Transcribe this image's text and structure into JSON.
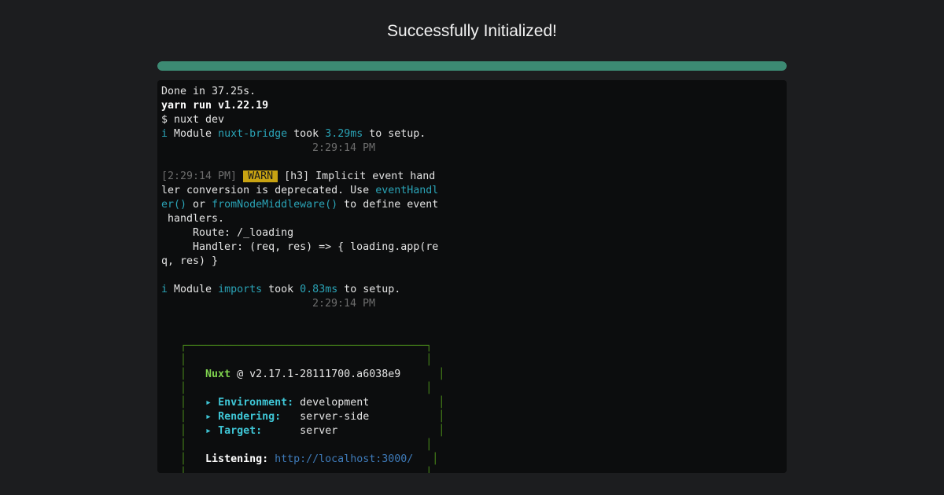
{
  "page": {
    "title": "Successfully Initialized!"
  },
  "progress": {
    "value": 1.0
  },
  "colors": {
    "background": "#1c1d1f",
    "progress": "#3c8a73",
    "terminal": "#0c0d0e",
    "warn": "#c8a312",
    "nuxt_green": "#7fd34e"
  },
  "terminal": {
    "done": "Done in 37.25s.",
    "yarn": "yarn run v1.22.19",
    "cmd": "$ nuxt dev",
    "info_icon": "i",
    "m1": {
      "pre": "Module ",
      "name": "nuxt-bridge",
      "took": " took ",
      "time": "3.29ms",
      "post": " to setup.",
      "ts": "2:29:14 PM"
    },
    "warn": {
      "ts": "[2:29:14 PM]",
      "badge": "WARN",
      "l1": "[h3] Implicit event hand",
      "l2": "ler conversion is deprecated. Use ",
      "l2b": "eventHandl",
      "l3a": "er()",
      "l3b": " or ",
      "l3c": "fromNodeMiddleware()",
      "l3d": " to define event",
      "l4": " handlers.",
      "l5": "     Route: /_loading",
      "l6": "     Handler: (req, res) => { loading.app(re",
      "l7": "q, res) }"
    },
    "m2": {
      "pre": "Module ",
      "name": "imports",
      "took": " took ",
      "time": "0.83ms",
      "post": " to setup.",
      "ts": "2:29:14 PM"
    },
    "box": {
      "top": "   ┌──────────────────────────────────────┐",
      "empty": "   │                                      │",
      "nuxt_name": "Nuxt",
      "nuxt_ver": " @ v2.17.1-28111700.a6038e9",
      "env_label": "Environment:",
      "env_value": "development",
      "render_label": "Rendering:",
      "render_value": "server-side",
      "target_label": "Target:",
      "target_value": "server",
      "listen_label": "Listening:",
      "listen_url": "http://localhost:3000/",
      "arrow": "▸"
    }
  }
}
